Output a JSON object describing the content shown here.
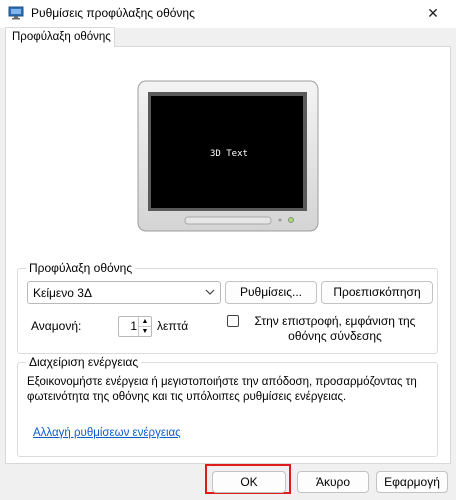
{
  "window": {
    "title": "Ρυθμίσεις προφύλαξης οθόνης",
    "close_glyph": "✕"
  },
  "tab": {
    "label": "Προφύλαξη οθόνης"
  },
  "preview": {
    "saver_text": "3D Text"
  },
  "screensaver": {
    "group_label": "Προφύλαξη οθόνης",
    "selected": "Κείμενο 3Δ",
    "settings_label": "Ρυθμίσεις...",
    "preview_label": "Προεπισκόπηση",
    "wait_label": "Αναμονή:",
    "wait_value": "1",
    "wait_unit": "λεπτά",
    "resume_label": "Στην επιστροφή, εμφάνιση της οθόνης σύνδεσης",
    "resume_checked": false
  },
  "power": {
    "group_label": "Διαχείριση ενέργειας",
    "description": "Εξοικονομήστε ενέργεια ή μεγιστοποιήστε την απόδοση, προσαρμόζοντας τη φωτεινότητα της οθόνης και τις υπόλοιπες ρυθμίσεις ενέργειας.",
    "link_label": "Αλλαγή ρυθμίσεων ενέργειας"
  },
  "buttons": {
    "ok": "OK",
    "cancel": "Άκυρο",
    "apply": "Εφαρμογή"
  },
  "colors": {
    "highlight": "#e01b1b",
    "link": "#0b5ec9"
  }
}
